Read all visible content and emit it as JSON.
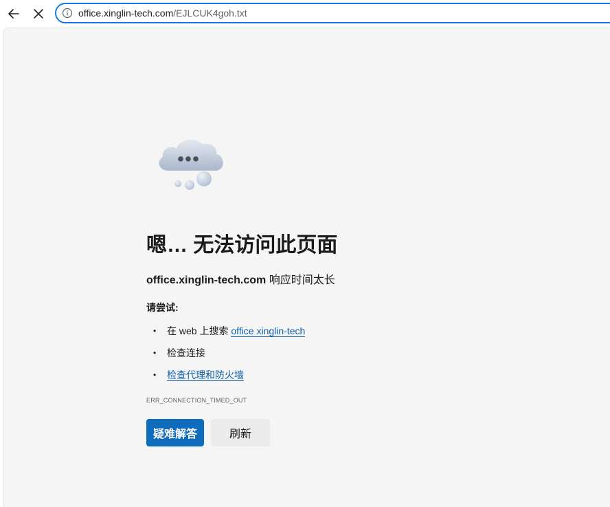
{
  "toolbar": {
    "back_icon": "arrow-left-icon",
    "stop_icon": "close-icon",
    "info_icon": "info-icon",
    "url_host": "office.xinglin-tech.com",
    "url_path": "/EJLCUK4goh.txt"
  },
  "error_page": {
    "illustration": "cloud-ellipsis-icon",
    "heading": "嗯… 无法访问此页面",
    "host": "office.xinglin-tech.com",
    "message": " 响应时间太长",
    "try_label": "请尝试:",
    "suggestions": {
      "search_prefix": "在 web 上搜索 ",
      "search_link": "office xinglin-tech",
      "check_connection": "检查连接",
      "check_proxy": "检查代理和防火墙"
    },
    "error_code": "ERR_CONNECTION_TIMED_OUT",
    "buttons": {
      "troubleshoot": "疑难解答",
      "refresh": "刷新"
    }
  },
  "colors": {
    "accent": "#1a73e8",
    "primary_button": "#0f6cbd",
    "link": "#0f5ea8",
    "page_bg": "#f5f5f6"
  }
}
